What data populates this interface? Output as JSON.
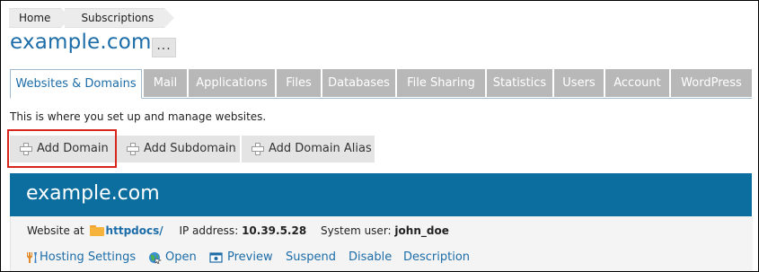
{
  "breadcrumbs": [
    "Home",
    "Subscriptions"
  ],
  "page_title": "example.com",
  "title_more": "...",
  "tabs": [
    {
      "label": "Websites & Domains",
      "active": true
    },
    {
      "label": "Mail"
    },
    {
      "label": "Applications"
    },
    {
      "label": "Files"
    },
    {
      "label": "Databases"
    },
    {
      "label": "File Sharing"
    },
    {
      "label": "Statistics"
    },
    {
      "label": "Users"
    },
    {
      "label": "Account"
    },
    {
      "label": "WordPress"
    }
  ],
  "intro_text": "This is where you set up and manage websites.",
  "toolbar": {
    "add_domain": "Add Domain",
    "add_subdomain": "Add Subdomain",
    "add_domain_alias": "Add Domain Alias"
  },
  "domain_card": {
    "title": "example.com",
    "website_at_label": "Website at",
    "docroot": "httpdocs/",
    "ip_label": "IP address:",
    "ip_value": "10.39.5.28",
    "user_label": "System user:",
    "user_value": "john_doe",
    "actions": {
      "hosting_settings": "Hosting Settings",
      "open": "Open",
      "preview": "Preview",
      "suspend": "Suspend",
      "disable": "Disable",
      "description": "Description"
    }
  },
  "colors": {
    "accent": "#1c6ca8",
    "card_header": "#0c6e9e",
    "tab_inactive": "#b8b8b8",
    "highlight": "#d9261c"
  },
  "icons": [
    "plus-icon",
    "folder-icon",
    "hosting-settings-icon",
    "open-globe-icon",
    "preview-icon"
  ]
}
